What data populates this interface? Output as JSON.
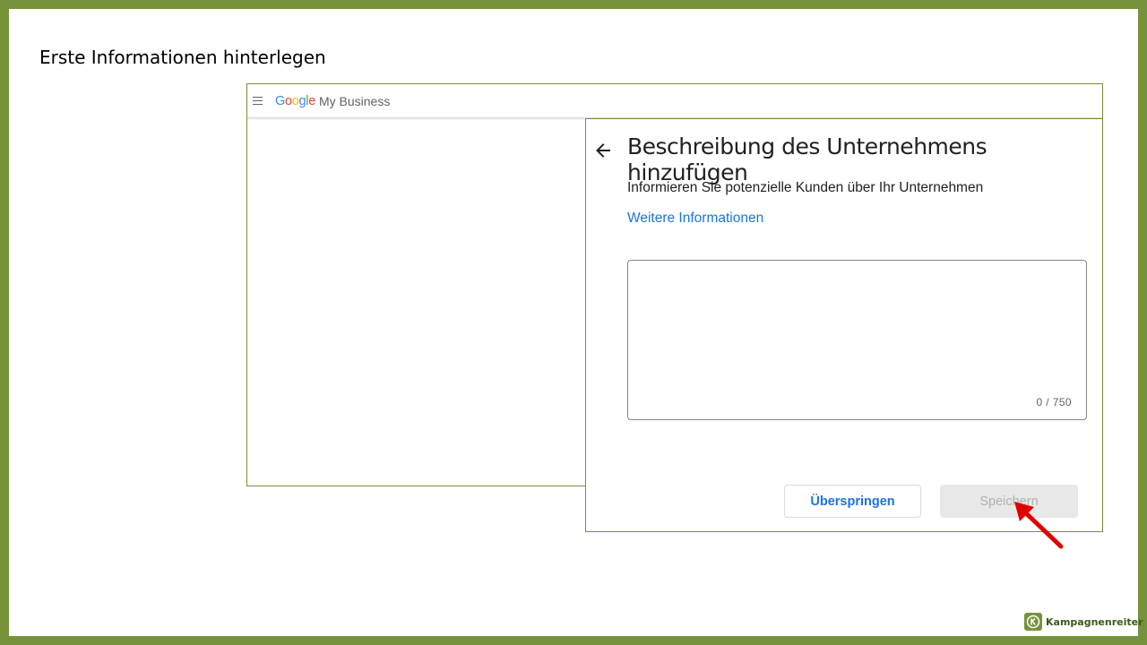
{
  "slide": {
    "title": "Erste Informationen hinterlegen"
  },
  "app": {
    "logo_letters": [
      {
        "char": "G",
        "color": "#4285F4"
      },
      {
        "char": "o",
        "color": "#EA4335"
      },
      {
        "char": "o",
        "color": "#FBBC05"
      },
      {
        "char": "g",
        "color": "#4285F4"
      },
      {
        "char": "l",
        "color": "#34A853"
      },
      {
        "char": "e",
        "color": "#EA4335"
      }
    ],
    "product_name": "My Business",
    "menu_icon": "hamburger-menu-icon"
  },
  "dialog": {
    "back_icon": "arrow-left-icon",
    "title": "Beschreibung des Unternehmens hinzufügen",
    "subtitle": "Informieren Sie potenzielle Kunden über Ihr Unternehmen",
    "link": "Weitere Informationen",
    "description_value": "",
    "counter": "0 / 750",
    "skip_label": "Überspringen",
    "save_label": "Speichern",
    "save_disabled": true
  },
  "annotation": {
    "arrow_color": "#e00000",
    "arrow_target": "save-button"
  },
  "brand": {
    "name": "Kampagnenreiter",
    "color": "#76933c"
  },
  "colors": {
    "frame": "#76933c",
    "link": "#1a73e8"
  }
}
